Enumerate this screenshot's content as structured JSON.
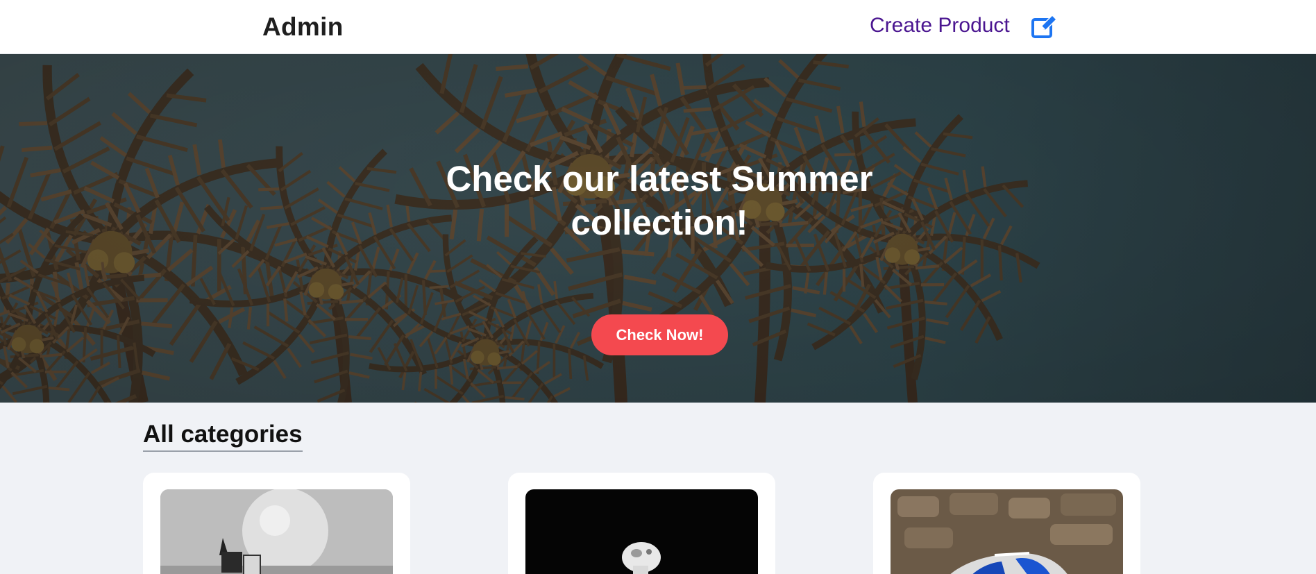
{
  "header": {
    "brand": "Admin",
    "create_label": "Create Product",
    "create_icon": "edit-icon",
    "link_color": "#4a1590",
    "icon_color": "#1d75f2"
  },
  "hero": {
    "title": "Check our latest Summer collection!",
    "button_label": "Check Now!",
    "button_color": "#f4494f"
  },
  "categories": {
    "heading": "All categories",
    "cards": [
      {
        "image": "monochrome-still-life-photo"
      },
      {
        "image": "wireless-earbud-photo"
      },
      {
        "image": "sneaker-photo"
      }
    ]
  }
}
